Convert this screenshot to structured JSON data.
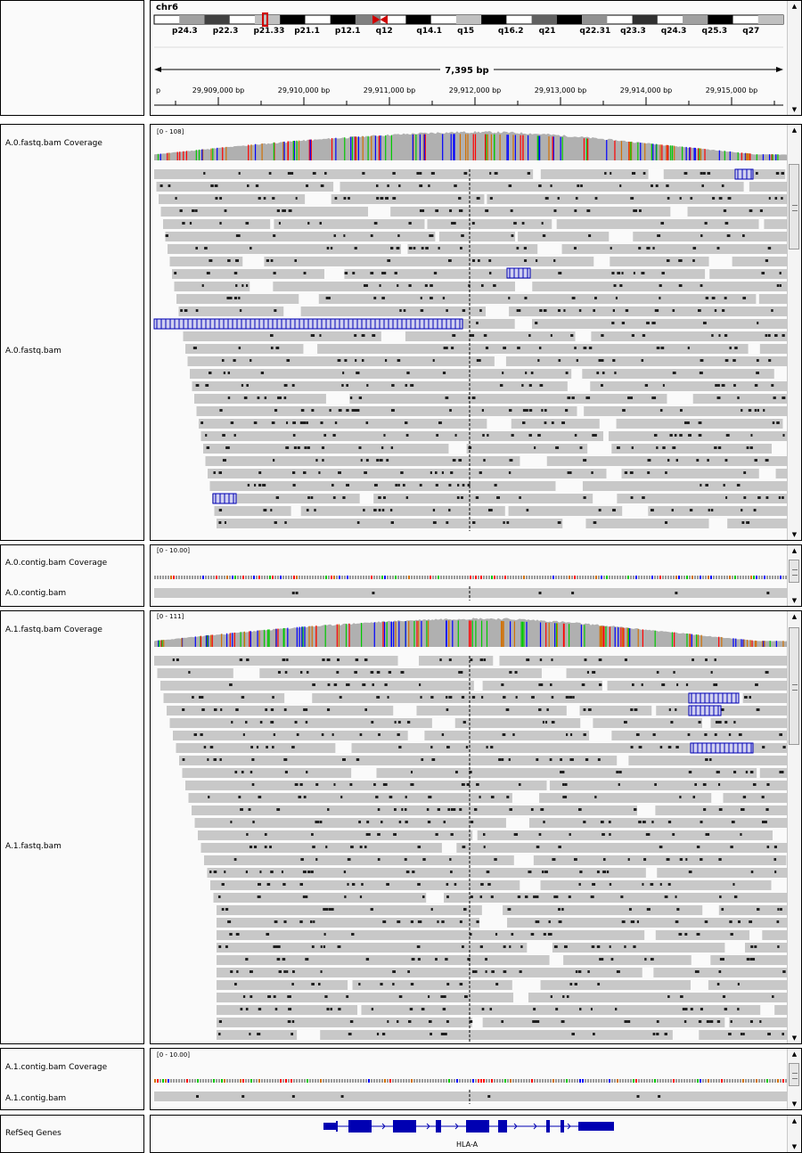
{
  "header": {
    "chromosome": "chr6",
    "bands": [
      "p24.3",
      "p22.3",
      "p21.33",
      "p21.1",
      "p12.1",
      "q12",
      "q14.1",
      "q15",
      "q16.2",
      "q21",
      "q22.31",
      "q23.3",
      "q24.3",
      "q25.3",
      "q27"
    ],
    "span_label": "7,395 bp",
    "ruler_start_label": "p",
    "ruler_ticks": [
      "29,909,000 bp",
      "29,910,000 bp",
      "29,911,000 bp",
      "29,912,000 bp",
      "29,913,000 bp",
      "29,914,000 bp",
      "29,915,000 bp"
    ]
  },
  "tracks": {
    "a0_coverage": {
      "name": "A.0.fastq.bam Coverage",
      "range": "[0 - 108]"
    },
    "a0_reads": {
      "name": "A.0.fastq.bam"
    },
    "a0_contig_coverage": {
      "name": "A.0.contig.bam Coverage",
      "range": "[0 - 10.00]"
    },
    "a0_contig_reads": {
      "name": "A.0.contig.bam"
    },
    "a1_coverage": {
      "name": "A.1.fastq.bam Coverage",
      "range": "[0 - 111]"
    },
    "a1_reads": {
      "name": "A.1.fastq.bam"
    },
    "a1_contig_coverage": {
      "name": "A.1.contig.bam Coverage",
      "range": "[0 - 10.00]"
    },
    "a1_contig_reads": {
      "name": "A.1.contig.bam"
    },
    "refseq": {
      "name": "RefSeq Genes",
      "gene": "HLA-A"
    }
  },
  "colors": {
    "read_gray": "#c8c8c8",
    "coverage_gray": "#b0b0b0",
    "mismatch_dark": "#1e1e1e",
    "highlight_blue": "#0000b4",
    "gene_blue": "#0000b2",
    "centromere_red": "#d00000",
    "allele_A": "#00c800",
    "allele_C": "#0000ff",
    "allele_G": "#d17105",
    "allele_T": "#ff0000"
  },
  "icons": [
    "scroll-up-icon",
    "scroll-down-icon",
    "centromere-icon",
    "strand-arrow-icon"
  ]
}
